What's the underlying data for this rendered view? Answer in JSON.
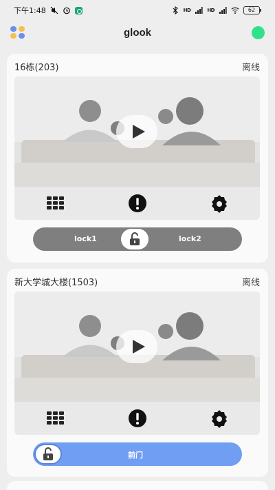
{
  "status_bar": {
    "time": "下午1:48",
    "battery": "62",
    "signal_1": "HD",
    "signal_2": "HD"
  },
  "header": {
    "title": "glook",
    "apps_icon": "apps-grid-icon",
    "connection_status_color": "#2ee28a"
  },
  "devices": [
    {
      "name": "16栋(203)",
      "status": "离线",
      "lock_style": "dual",
      "locks": [
        "lock1",
        "lock2"
      ]
    },
    {
      "name": "新大学城大楼(1503)",
      "status": "离线",
      "lock_style": "single",
      "locks": [
        "前门"
      ]
    }
  ],
  "colors": {
    "accent_blue": "#6f9ef2",
    "lock_gray": "#7f7f7f",
    "online_green": "#2ee28a"
  }
}
